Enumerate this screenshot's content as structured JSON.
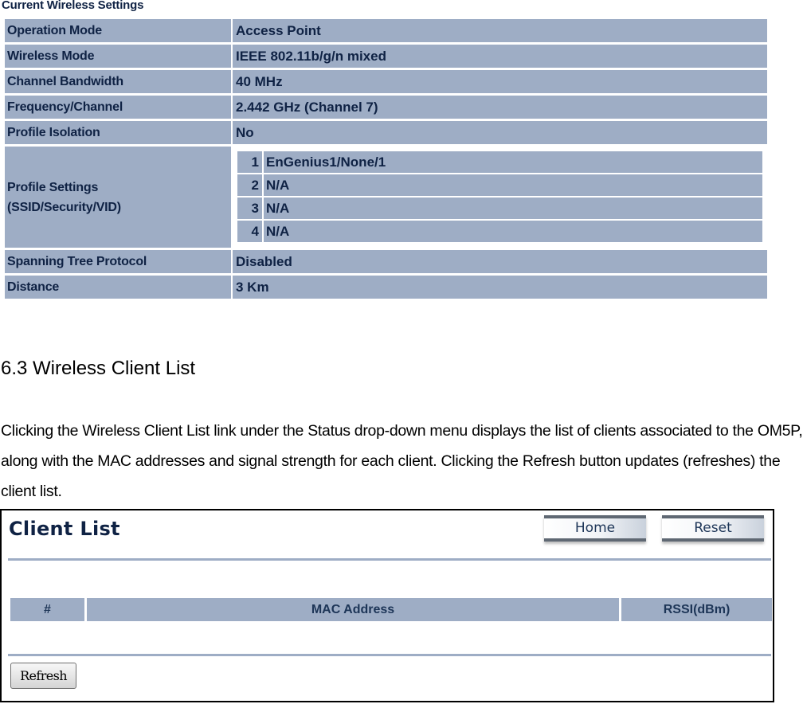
{
  "wireless_settings": {
    "title": "Current Wireless Settings",
    "rows": [
      {
        "label": "Operation Mode",
        "value": "Access Point"
      },
      {
        "label": "Wireless Mode",
        "value": "IEEE 802.11b/g/n mixed"
      },
      {
        "label": "Channel Bandwidth",
        "value": "40 MHz"
      },
      {
        "label": "Frequency/Channel",
        "value": "2.442 GHz (Channel 7)"
      },
      {
        "label": "Profile Isolation",
        "value": "No"
      }
    ],
    "profile_settings": {
      "label_line1": "Profile Settings",
      "label_line2": "(SSID/Security/VID)",
      "profiles": [
        {
          "num": "1",
          "value": "EnGenius1/None/1"
        },
        {
          "num": "2",
          "value": "N/A"
        },
        {
          "num": "3",
          "value": "N/A"
        },
        {
          "num": "4",
          "value": "N/A"
        }
      ]
    },
    "rows_after": [
      {
        "label": "Spanning Tree Protocol",
        "value": "Disabled"
      },
      {
        "label": "Distance",
        "value": "3 Km"
      }
    ]
  },
  "section": {
    "title": "6.3 Wireless Client List",
    "paragraph": "Clicking the Wireless Client List link under the Status drop-down  menu displays the list of clients associated to the OM5P, along with the MAC addresses and signal strength for each client. Clicking the Refresh button  updates (refreshes) the client list."
  },
  "client_list": {
    "title": "Client List",
    "buttons": {
      "home": "Home",
      "reset": "Reset",
      "refresh": "Refresh"
    },
    "columns": [
      "#",
      "MAC Address",
      "RSSI(dBm)"
    ],
    "rows": []
  },
  "colors": {
    "cell_bg": "#9eadc5",
    "text_navy": "#0f2244"
  }
}
